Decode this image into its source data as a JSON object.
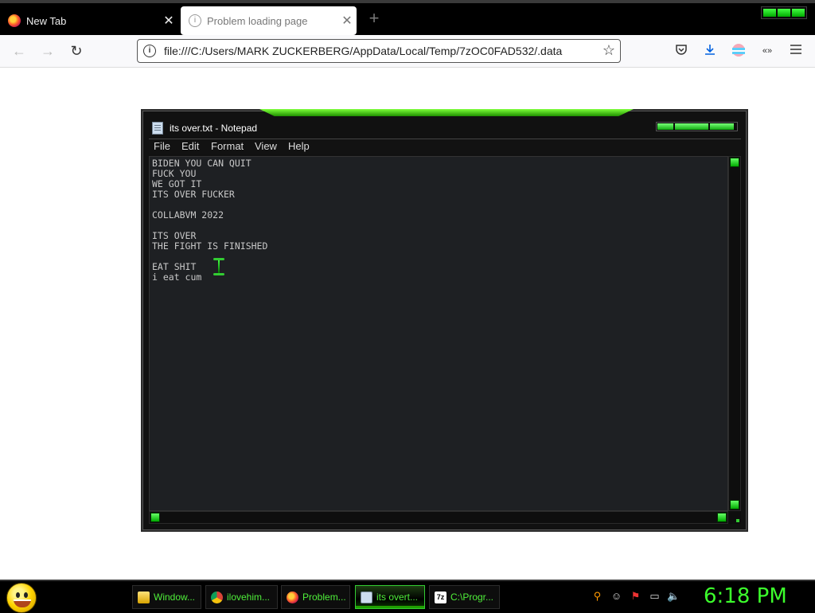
{
  "browser": {
    "tabs": [
      {
        "label": "New Tab",
        "close": "✕"
      },
      {
        "label": "Problem loading page",
        "close": "✕"
      }
    ],
    "new_tab_symbol": "+",
    "url": "file:///C:/Users/MARK ZUCKERBERG/AppData/Local/Temp/7zOC0FAD532/.data",
    "nav": {
      "back": "←",
      "forward": "→",
      "reload": "↻",
      "bookmark": "☆",
      "info": "i"
    },
    "toolbar_icons": [
      "pocket-icon",
      "downloads-icon",
      "account-icon",
      "extensions-icon",
      "menu-icon"
    ]
  },
  "notepad": {
    "title": "its over.txt - Notepad",
    "menu": [
      "File",
      "Edit",
      "Format",
      "View",
      "Help"
    ],
    "content": "BIDEN YOU CAN QUIT\nFUCK YOU\nWE GOT IT\nITS OVER FUCKER\n\nCOLLABVM 2022\n\nITS OVER\nTHE FIGHT IS FINISHED\n\nEAT SHIT\ni eat cum"
  },
  "taskbar": {
    "buttons": [
      {
        "label": "Window...",
        "icon": "folder-icon",
        "active": false
      },
      {
        "label": "ilovehim...",
        "icon": "chrome-icon",
        "active": false
      },
      {
        "label": "Problem...",
        "icon": "firefox-icon",
        "active": false
      },
      {
        "label": "its overt...",
        "icon": "notepad-icon",
        "active": true
      },
      {
        "label": "C:\\Progr...",
        "icon": "7zip-icon",
        "active": false
      }
    ],
    "clock": "6:18 PM",
    "accent_color": "#3cff2c"
  }
}
